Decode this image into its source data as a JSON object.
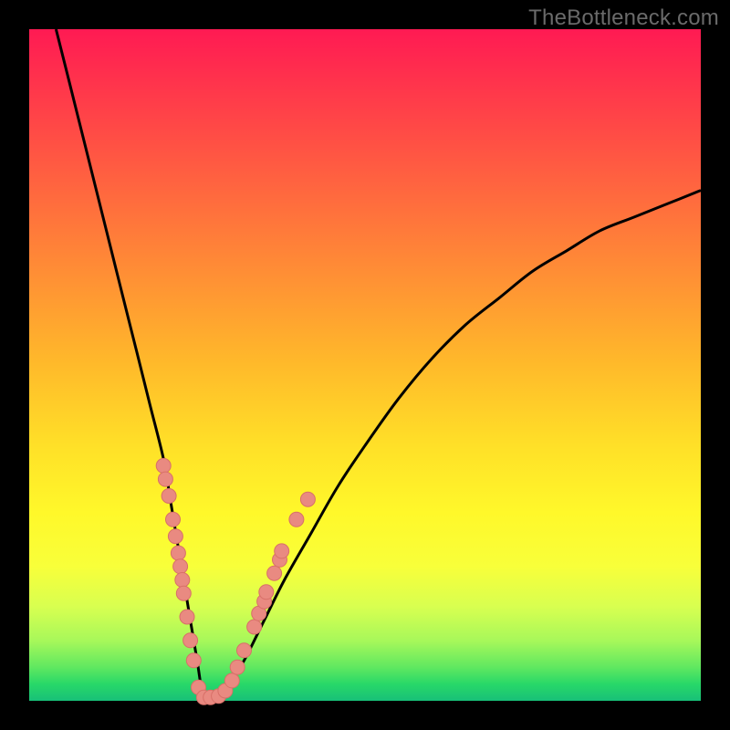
{
  "watermark": "TheBottleneck.com",
  "colors": {
    "background": "#000000",
    "curve": "#000000",
    "marker_fill": "#e98a81",
    "marker_stroke": "#d87068"
  },
  "chart_data": {
    "type": "line",
    "title": "",
    "xlabel": "",
    "ylabel": "",
    "xlim": [
      0,
      100
    ],
    "ylim": [
      0,
      100
    ],
    "grid": false,
    "legend": false,
    "series": [
      {
        "name": "bottleneck-curve",
        "x": [
          4,
          6,
          8,
          10,
          12,
          14,
          16,
          18,
          20,
          21,
          22,
          23,
          24,
          25,
          26,
          27,
          28,
          30,
          32,
          35,
          38,
          42,
          46,
          50,
          55,
          60,
          65,
          70,
          75,
          80,
          85,
          90,
          95,
          100
        ],
        "y": [
          100,
          92,
          84,
          76,
          68,
          60,
          52,
          44,
          36,
          30,
          24,
          18,
          12,
          6,
          0,
          0,
          0,
          3,
          6,
          12,
          18,
          25,
          32,
          38,
          45,
          51,
          56,
          60,
          64,
          67,
          70,
          72,
          74,
          76
        ]
      }
    ],
    "markers": [
      {
        "x": 20.0,
        "y": 35.0
      },
      {
        "x": 20.3,
        "y": 33.0
      },
      {
        "x": 20.8,
        "y": 30.5
      },
      {
        "x": 21.4,
        "y": 27.0
      },
      {
        "x": 21.8,
        "y": 24.5
      },
      {
        "x": 22.2,
        "y": 22.0
      },
      {
        "x": 22.5,
        "y": 20.0
      },
      {
        "x": 22.8,
        "y": 18.0
      },
      {
        "x": 23.0,
        "y": 16.0
      },
      {
        "x": 23.5,
        "y": 12.5
      },
      {
        "x": 24.0,
        "y": 9.0
      },
      {
        "x": 24.5,
        "y": 6.0
      },
      {
        "x": 25.2,
        "y": 2.0
      },
      {
        "x": 26.0,
        "y": 0.5
      },
      {
        "x": 27.0,
        "y": 0.5
      },
      {
        "x": 28.2,
        "y": 0.7
      },
      {
        "x": 29.2,
        "y": 1.5
      },
      {
        "x": 30.2,
        "y": 3.0
      },
      {
        "x": 31.0,
        "y": 5.0
      },
      {
        "x": 32.0,
        "y": 7.5
      },
      {
        "x": 33.5,
        "y": 11.0
      },
      {
        "x": 34.2,
        "y": 13.0
      },
      {
        "x": 35.0,
        "y": 14.8
      },
      {
        "x": 35.3,
        "y": 16.2
      },
      {
        "x": 36.5,
        "y": 19.0
      },
      {
        "x": 37.3,
        "y": 21.0
      },
      {
        "x": 37.6,
        "y": 22.3
      },
      {
        "x": 39.8,
        "y": 27.0
      },
      {
        "x": 41.5,
        "y": 30.0
      }
    ]
  }
}
